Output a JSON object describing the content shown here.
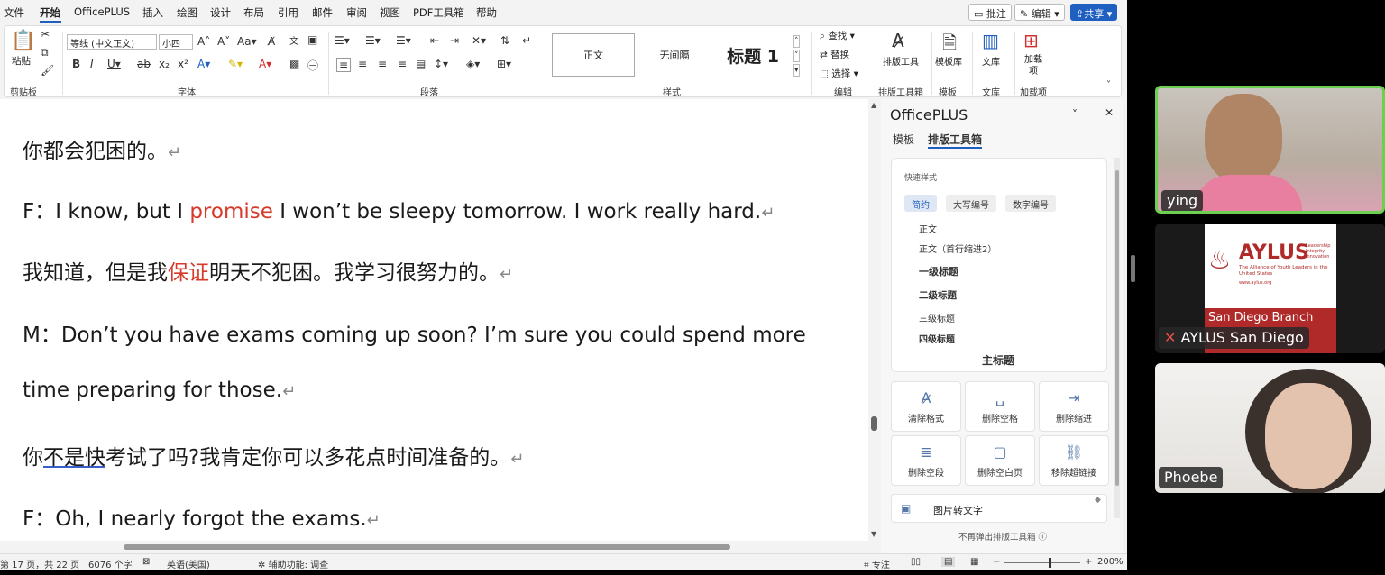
{
  "menu": {
    "items": [
      "文件",
      "开始",
      "OfficePLUS",
      "插入",
      "绘图",
      "设计",
      "布局",
      "引用",
      "邮件",
      "审阅",
      "视图",
      "PDF工具箱",
      "帮助"
    ],
    "active": "开始",
    "comment_label": "批注",
    "edit_label": "编辑",
    "share_label": "共享"
  },
  "ribbon": {
    "clipboard": {
      "paste_label": "粘贴",
      "group_label": "剪贴板"
    },
    "font": {
      "font_name": "等线 (中文正文)",
      "font_size": "小四",
      "group_label": "字体"
    },
    "paragraph": {
      "group_label": "段落"
    },
    "styles": {
      "items": [
        "正文",
        "无间隔",
        "标题 1"
      ],
      "group_label": "样式"
    },
    "editing": {
      "find": "查找",
      "replace": "替换",
      "select": "选择",
      "group_label": "编辑"
    },
    "layout_tools": {
      "label": "排版工具",
      "group_label": "排版工具箱"
    },
    "templates": {
      "label": "模板库",
      "group_label": "模板"
    },
    "library": {
      "label": "文库",
      "group_label": "文库"
    },
    "addins": {
      "label": "加载项",
      "group_label": "加载项"
    }
  },
  "document": {
    "lines": [
      {
        "segments": [
          {
            "text": "你都会犯困的。"
          }
        ]
      },
      {
        "segments": [
          {
            "text": "F：I know, but I "
          },
          {
            "text": "promise",
            "style": "red"
          },
          {
            "text": " I won’t be sleepy tomorrow. I work really hard."
          }
        ]
      },
      {
        "segments": [
          {
            "text": "我知道，但是我"
          },
          {
            "text": "保证",
            "style": "red"
          },
          {
            "text": "明天不犯困。我学习很努力的。"
          }
        ]
      },
      {
        "segments": [
          {
            "text": "M：Don’t you have exams coming up soon? I’m sure you could spend more"
          }
        ]
      },
      {
        "segments": [
          {
            "text": "time preparing for those."
          }
        ]
      },
      {
        "segments": [
          {
            "text": "你"
          },
          {
            "text": "不是快",
            "style": "ul"
          },
          {
            "text": "考试了吗?我肯定你可以多花点时间准备的。"
          }
        ]
      },
      {
        "segments": [
          {
            "text": "F：Oh, I nearly forgot the exams."
          }
        ]
      }
    ],
    "paragraph_mark": "↵"
  },
  "panel": {
    "title": "OfficePLUS",
    "tabs": [
      "模板",
      "排版工具箱"
    ],
    "active_tab": "排版工具箱",
    "quick_styles": {
      "title": "快速样式",
      "chips": [
        "简约",
        "大写编号",
        "数字编号"
      ],
      "active_chip": "简约",
      "items": [
        {
          "label": "正文",
          "bold": false
        },
        {
          "label": "正文（首行缩进2）",
          "bold": false
        },
        {
          "label": "一级标题",
          "bold": true
        },
        {
          "label": "二级标题",
          "bold": true
        },
        {
          "label": "三级标题",
          "bold": false
        },
        {
          "label": "四级标题",
          "bold": false
        }
      ],
      "main_title": "主标题"
    },
    "tools": [
      {
        "label": "清除格式",
        "icon": "clear-format-icon",
        "glyph": "A̷"
      },
      {
        "label": "删除空格",
        "icon": "delete-space-icon",
        "glyph": "␣"
      },
      {
        "label": "删除缩进",
        "icon": "delete-indent-icon",
        "glyph": "⇥"
      },
      {
        "label": "删除空段",
        "icon": "delete-empty-paragraph-icon",
        "glyph": "≣"
      },
      {
        "label": "删除空白页",
        "icon": "delete-blank-page-icon",
        "glyph": "▢"
      },
      {
        "label": "移除超链接",
        "icon": "remove-hyperlink-icon",
        "glyph": "⛓"
      }
    ],
    "image_to_text": "图片转文字",
    "footer": "不再弹出排版工具箱"
  },
  "status": {
    "page": "第 17 页，共 22 页",
    "words": "6076 个字",
    "language": "英语(美国)",
    "accessibility": "辅助功能: 调查",
    "focus": "专注",
    "zoom": "200%"
  },
  "video": {
    "participants": [
      {
        "name": "ying",
        "active_speaker": true,
        "muted": false
      },
      {
        "name": "AYLUS San Diego",
        "muted": true,
        "logo_title": "AYLUS",
        "logo_subtitle": "The Alliance of Youth Leaders in the United States",
        "logo_tagline": "Leadership Integrity Innovation",
        "logo_url": "www.aylus.org",
        "branch": "San Diego Branch"
      },
      {
        "name": "Phoebe",
        "muted": false
      }
    ]
  },
  "colors": {
    "accent": "#1f5fbf",
    "red_text": "#d63a2a",
    "active_speaker_border": "#6ccf4f"
  }
}
